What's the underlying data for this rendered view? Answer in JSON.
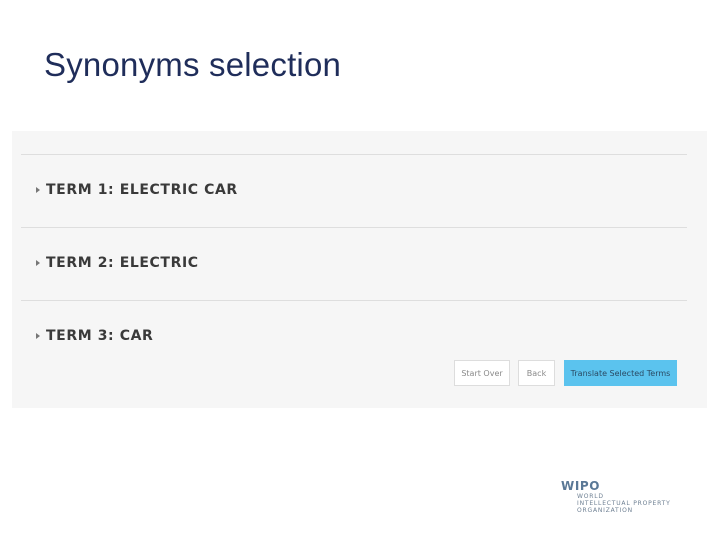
{
  "slide": {
    "title": "Synonyms selection"
  },
  "terms": [
    {
      "label": "TERM 1: ELECTRIC CAR"
    },
    {
      "label": "TERM 2: ELECTRIC"
    },
    {
      "label": "TERM 3: CAR"
    }
  ],
  "actions": {
    "start_over": "Start Over",
    "back": "Back",
    "translate": "Translate Selected Terms"
  },
  "logo": {
    "mark": "WIPO",
    "lines": [
      "WORLD",
      "INTELLECTUAL PROPERTY",
      "ORGANIZATION"
    ]
  },
  "colors": {
    "accent": "#5bc3ee",
    "panel_bg": "#f6f6f6",
    "title": "#1f2d5a"
  }
}
